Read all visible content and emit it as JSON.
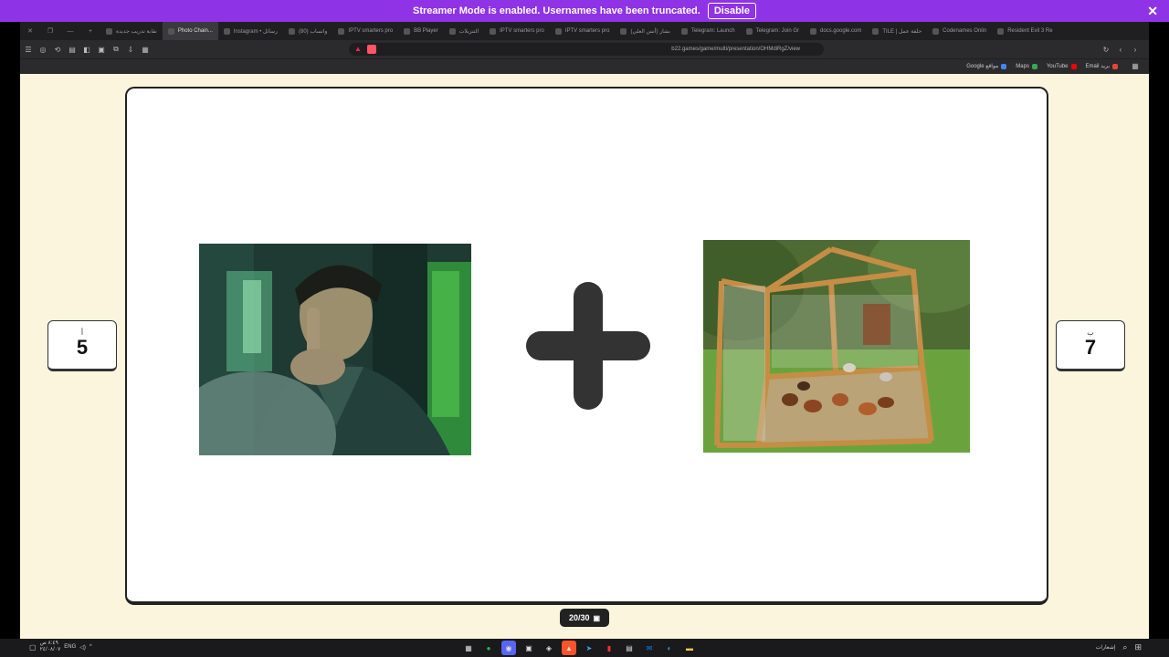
{
  "banner": {
    "message": "Streamer Mode is enabled. Usernames have been truncated.",
    "disable_label": "Disable",
    "close_glyph": "✕",
    "color": "#8e33e6"
  },
  "tabs": [
    {
      "label": "نقابة تدريب جديدة",
      "active": false
    },
    {
      "label": "Photo Chain...",
      "active": true
    },
    {
      "label": "Instagram • رسائل",
      "active": false
    },
    {
      "label": "(80) واتساب",
      "active": false
    },
    {
      "label": "IPTV smarters pro",
      "active": false
    },
    {
      "label": "BB Player",
      "active": false
    },
    {
      "label": "التنزيلات",
      "active": false
    },
    {
      "label": "IPTV smarters pro",
      "active": false
    },
    {
      "label": "IPTV smarters pro",
      "active": false
    },
    {
      "label": "(أنس العلي) بشار",
      "active": false
    },
    {
      "label": "Telegram: Launch",
      "active": false
    },
    {
      "label": "Telegram: Join Gr",
      "active": false
    },
    {
      "label": "docs.google.com",
      "active": false
    },
    {
      "label": "TILE | حلقة عمل",
      "active": false
    },
    {
      "label": "Codenames Onlin",
      "active": false
    },
    {
      "label": "Resident Evil 3 Re",
      "active": false
    }
  ],
  "toolbar": {
    "url": "b22.games/game/multi/presentation/OHMdiRgZ/view"
  },
  "bookmarks": [
    {
      "label": "Google مواقع",
      "color": "#4285f4"
    },
    {
      "label": "Maps",
      "color": "#34a853"
    },
    {
      "label": "YouTube",
      "color": "#ff0000"
    },
    {
      "label": "Email بريد",
      "color": "#ea4335"
    }
  ],
  "game": {
    "left_score_label": "أ",
    "left_score": "5",
    "right_score_label": "ب",
    "right_score": "7",
    "plus_icon": "plus-icon",
    "counter": "20/30"
  },
  "taskbar": {
    "time": "٨:٤٩ ص",
    "date": "٢٤/٠٨/٠٧",
    "lang": "ENG",
    "notifications": "إشعارات"
  }
}
